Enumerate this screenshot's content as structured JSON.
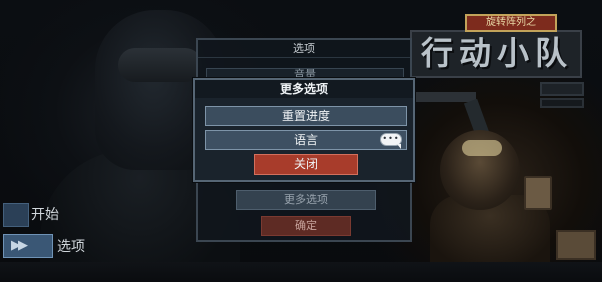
{
  "background": {
    "title_tag": "旋转阵列之",
    "title_main": "行动小队"
  },
  "main_menu": {
    "items": [
      {
        "label": "开始",
        "selected": false
      },
      {
        "label": "选项",
        "selected": true
      }
    ]
  },
  "options_panel": {
    "title": "选项",
    "volume_label": "音量",
    "more_options_label": "更多选项",
    "confirm_label": "确定"
  },
  "more_options_dialog": {
    "title": "更多选项",
    "reset_progress_label": "重置进度",
    "language_label": "语言",
    "close_label": "关闭",
    "language_badge": "•••"
  },
  "colors": {
    "dialog_bg": "#1a232c",
    "button_blue": "#3b4d5e",
    "close_red": "#a83c2b",
    "menu_blue": "#2b4057"
  }
}
